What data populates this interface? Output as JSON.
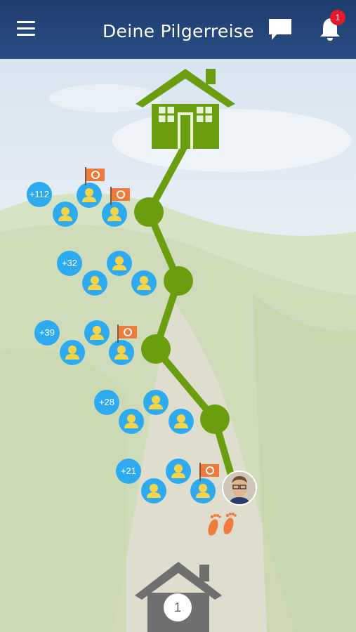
{
  "header": {
    "title": "Deine Pilgerreise",
    "notification_count": "1",
    "icons": [
      "menu-icon",
      "chat-icon",
      "bell-icon"
    ]
  },
  "journey": {
    "rows": [
      {
        "extra_count": "+112",
        "members": 3,
        "flags": 2
      },
      {
        "extra_count": "+32",
        "members": 3,
        "flags": 0
      },
      {
        "extra_count": "+39",
        "members": 3,
        "flags": 1
      },
      {
        "extra_count": "+28",
        "members": 3,
        "flags": 0
      },
      {
        "extra_count": "+21",
        "members": 3,
        "flags": 1
      }
    ],
    "stages_completed": 4,
    "goal_icon": "green-house-icon"
  },
  "bottom": {
    "home_count": "1"
  },
  "colors": {
    "header": "#284e84",
    "path": "#6a9e0f",
    "bubble": "#2eaaf0",
    "flag": "#f07a3a",
    "badge": "#e5192c"
  }
}
